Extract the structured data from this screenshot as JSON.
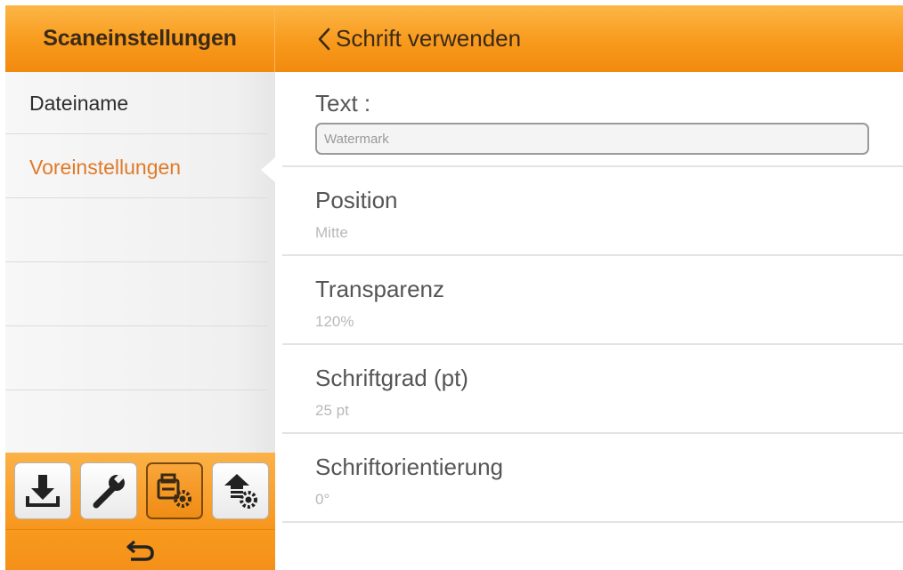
{
  "header": {
    "left_title": "Scaneinstellungen",
    "right_title": "Schrift verwenden",
    "back_icon": "chevron-left-icon"
  },
  "sidebar": {
    "items": [
      {
        "label": "Dateiname",
        "active": false
      },
      {
        "label": "Voreinstellungen",
        "active": true
      }
    ]
  },
  "toolbar": {
    "buttons": [
      {
        "icon": "download-icon",
        "active": false
      },
      {
        "icon": "wrench-icon",
        "active": false
      },
      {
        "icon": "scanner-settings-icon",
        "active": true
      },
      {
        "icon": "upload-settings-icon",
        "active": false
      }
    ],
    "back_icon": "return-arrow-icon"
  },
  "settings": {
    "text_label": "Text :",
    "text_placeholder": "Watermark",
    "text_value": "",
    "position_label": "Position",
    "position_value": "Mitte",
    "transparency_label": "Transparenz",
    "transparency_value": "120%",
    "fontsize_label": "Schriftgrad (pt)",
    "fontsize_value": "25 pt",
    "orientation_label": "Schriftorientierung",
    "orientation_value": "0°"
  },
  "colors": {
    "accent": "#f89a1c",
    "active_text": "#e07a28"
  }
}
